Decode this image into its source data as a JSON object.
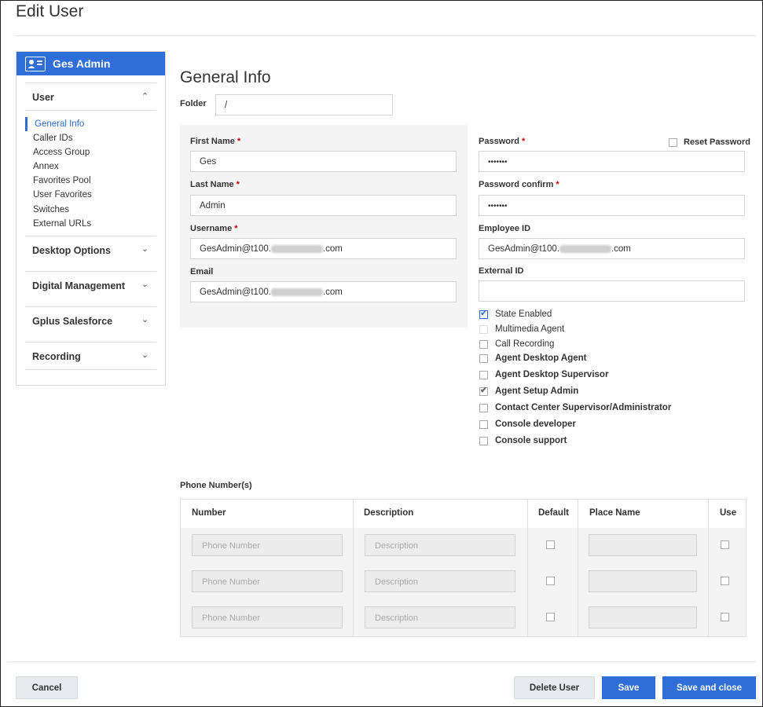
{
  "page": {
    "title": "Edit User"
  },
  "sidebar": {
    "user_name": "Ges Admin",
    "sections": [
      {
        "title": "User",
        "expanded": true
      },
      {
        "title": "Desktop Options",
        "expanded": false
      },
      {
        "title": "Digital Management",
        "expanded": false
      },
      {
        "title": "Gplus Salesforce",
        "expanded": false
      },
      {
        "title": "Recording",
        "expanded": false
      }
    ],
    "user_items": [
      "General Info",
      "Caller IDs",
      "Access Group",
      "Annex",
      "Favorites Pool",
      "User Favorites",
      "Switches",
      "External URLs"
    ],
    "active_item": "General Info",
    "chevron_up": "⌃",
    "chevron_down": "⌄"
  },
  "form": {
    "section_title": "General Info",
    "folder": {
      "label": "Folder",
      "value": "/"
    },
    "first_name": {
      "label": "First Name",
      "value": "Ges"
    },
    "last_name": {
      "label": "Last Name",
      "value": "Admin"
    },
    "username": {
      "label": "Username",
      "value_prefix": "GesAdmin@t100.",
      "value_suffix": ".com"
    },
    "email": {
      "label": "Email",
      "value_prefix": "GesAdmin@t100.",
      "value_suffix": ".com"
    },
    "required_mark": "*",
    "password": {
      "label": "Password",
      "value": "•••••••"
    },
    "reset_password": {
      "label": "Reset Password",
      "checked": false
    },
    "password_confirm": {
      "label": "Password confirm",
      "value": "•••••••"
    },
    "employee_id": {
      "label": "Employee ID",
      "value_prefix": "GesAdmin@t100.",
      "value_suffix": ".com"
    },
    "external_id": {
      "label": "External ID",
      "value": ""
    },
    "checkboxes": [
      {
        "label": "State Enabled",
        "checked": true,
        "bold": false
      },
      {
        "label": "Multimedia Agent",
        "checked": false,
        "bold": false
      },
      {
        "label": "Call Recording",
        "checked": false,
        "bold": false
      },
      {
        "label": "Agent Desktop Agent",
        "checked": false,
        "bold": true
      },
      {
        "label": "Agent Desktop Supervisor",
        "checked": false,
        "bold": true
      },
      {
        "label": "Agent Setup Admin",
        "checked": true,
        "bold": true
      },
      {
        "label": "Contact Center Supervisor/Administrator",
        "checked": false,
        "bold": true
      },
      {
        "label": "Console developer",
        "checked": false,
        "bold": true
      },
      {
        "label": "Console support",
        "checked": false,
        "bold": true
      }
    ],
    "check_glyph": "✔"
  },
  "phones": {
    "title": "Phone Number(s)",
    "columns": [
      "Number",
      "Description",
      "Default",
      "Place Name",
      "Use"
    ],
    "number_placeholder": "Phone Number",
    "description_placeholder": "Description",
    "row_count": 3
  },
  "footer": {
    "cancel": "Cancel",
    "delete": "Delete User",
    "save": "Save",
    "save_close": "Save and close"
  },
  "colors": {
    "accent": "#2f6dd8",
    "required": "#cc0000"
  }
}
